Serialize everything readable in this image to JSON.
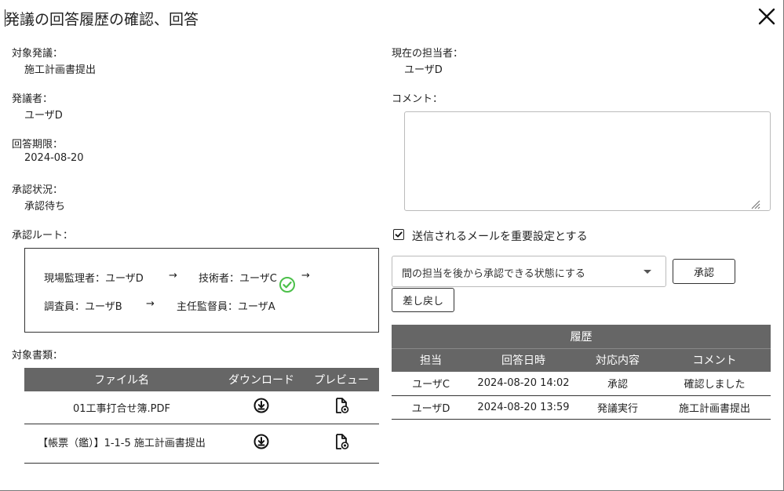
{
  "dialog": {
    "title": "発議の回答履歴の確認、回答"
  },
  "left": {
    "target_label": "対象発議：",
    "target_value": "施工計画書提出",
    "issuer_label": "発議者：",
    "issuer_value": "ユーザD",
    "deadline_label": "回答期限：",
    "deadline_value": "2024-08-20",
    "status_label": "承認状況：",
    "status_value": "承認待ち",
    "route_label": "承認ルート：",
    "route": {
      "step1": "現場監理者：ユーザD",
      "step2": "技術者：ユーザC",
      "step3": "調査員：ユーザB",
      "step4": "主任監督員：ユーザA",
      "arrow": "→"
    },
    "docs_label": "対象書類：",
    "docs_table": {
      "headers": [
        "ファイル名",
        "ダウンロード",
        "プレビュー"
      ],
      "rows": [
        {
          "filename": "01工事打合せ簿.PDF"
        },
        {
          "filename": "【帳票（鑑）】1-1-5 施工計画書提出"
        }
      ]
    }
  },
  "right": {
    "assignee_label": "現在の担当者：",
    "assignee_value": "ユーザD",
    "comment_label": "コメント：",
    "comment_value": "",
    "important_mail_label": "送信されるメールを重要設定とする",
    "important_mail_checked": true,
    "select_value": "間の担当を後から承認できる状態にする",
    "approve_label": "承認",
    "reject_label": "差し戻し",
    "history_table": {
      "caption": "履歴",
      "headers": [
        "担当",
        "回答日時",
        "対応内容",
        "コメント"
      ],
      "rows": [
        [
          "ユーザC",
          "2024-08-20 14:02",
          "承認",
          "確認しました"
        ],
        [
          "ユーザD",
          "2024-08-20 13:59",
          "発議実行",
          "施工計画書提出"
        ]
      ]
    }
  },
  "colors": {
    "header_bg": "#666666",
    "check_green": "#4cc04a"
  }
}
